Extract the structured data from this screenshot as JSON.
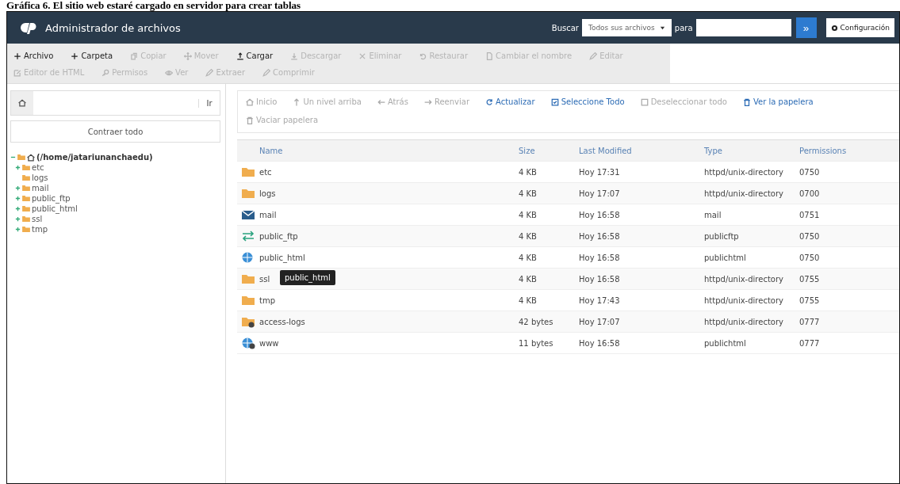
{
  "caption": "Gráfica 6. El sitio web estaré cargado en servidor para crear tablas",
  "header": {
    "title": "Administrador de archivos",
    "search_label": "Buscar",
    "search_scope": "Todos sus archivos",
    "for_label": "para",
    "go": "»",
    "settings": "Configuración"
  },
  "toolbar": [
    {
      "label": "Archivo",
      "kind": "plus",
      "disabled": false
    },
    {
      "label": "Carpeta",
      "kind": "plus",
      "disabled": false
    },
    {
      "label": "Copiar",
      "kind": "copy",
      "disabled": true
    },
    {
      "label": "Mover",
      "kind": "move",
      "disabled": true
    },
    {
      "label": "Cargar",
      "kind": "upload",
      "disabled": false
    },
    {
      "label": "Descargar",
      "kind": "download",
      "disabled": true
    },
    {
      "label": "Eliminar",
      "kind": "x",
      "disabled": true
    },
    {
      "label": "Restaurar",
      "kind": "undo",
      "disabled": true
    },
    {
      "label": "Cambiar el nombre",
      "kind": "file",
      "disabled": true
    },
    {
      "label": "Editar",
      "kind": "pencil",
      "disabled": true
    },
    {
      "label": "Editor de HTML",
      "kind": "edit",
      "disabled": true
    },
    {
      "label": "Permisos",
      "kind": "key",
      "disabled": true
    },
    {
      "label": "Ver",
      "kind": "eye",
      "disabled": true
    },
    {
      "label": "Extraer",
      "kind": "pencil",
      "disabled": true
    },
    {
      "label": "Comprimir",
      "kind": "pencil",
      "disabled": true
    }
  ],
  "sidebar": {
    "path_button": "Ir",
    "collapse_all": "Contraer todo",
    "tree": {
      "label": "(/home/jatariunanchaedu)",
      "expanded": true,
      "children": [
        {
          "label": "etc",
          "expanded": false
        },
        {
          "label": "logs"
        },
        {
          "label": "mail",
          "expanded": false
        },
        {
          "label": "public_ftp",
          "expanded": false
        },
        {
          "label": "public_html",
          "expanded": false
        },
        {
          "label": "ssl",
          "expanded": false
        },
        {
          "label": "tmp",
          "expanded": false
        }
      ]
    }
  },
  "nav": [
    {
      "label": "Inicio",
      "kind": "home",
      "disabled": true
    },
    {
      "label": "Un nivel arriba",
      "kind": "up",
      "disabled": true
    },
    {
      "label": "Atrás",
      "kind": "left",
      "disabled": true
    },
    {
      "label": "Reenviar",
      "kind": "right",
      "disabled": true
    },
    {
      "label": "Actualizar",
      "kind": "refresh",
      "disabled": false
    },
    {
      "label": "Seleccione Todo",
      "kind": "checkbox",
      "disabled": false
    },
    {
      "label": "Deseleccionar todo",
      "kind": "square",
      "disabled": true
    },
    {
      "label": "Ver la papelera",
      "kind": "trash",
      "disabled": false
    },
    {
      "label": "Vaciar papelera",
      "kind": "trash",
      "disabled": true
    }
  ],
  "table": {
    "columns": [
      "Name",
      "Size",
      "Last Modified",
      "Type",
      "Permissions"
    ],
    "rows": [
      {
        "kind": "folder",
        "name": "etc",
        "size": "4 KB",
        "modified": "Hoy 17:31",
        "type": "httpd/unix-directory",
        "permissions": "0750"
      },
      {
        "kind": "folder",
        "name": "logs",
        "size": "4 KB",
        "modified": "Hoy 17:07",
        "type": "httpd/unix-directory",
        "permissions": "0700"
      },
      {
        "kind": "mail",
        "name": "mail",
        "size": "4 KB",
        "modified": "Hoy 16:58",
        "type": "mail",
        "permissions": "0751"
      },
      {
        "kind": "transfer",
        "name": "public_ftp",
        "size": "4 KB",
        "modified": "Hoy 16:58",
        "type": "publicftp",
        "permissions": "0750"
      },
      {
        "kind": "globe",
        "name": "public_html",
        "size": "4 KB",
        "modified": "Hoy 16:58",
        "type": "publichtml",
        "permissions": "0750"
      },
      {
        "kind": "folder",
        "name": "ssl",
        "size": "4 KB",
        "modified": "Hoy 16:58",
        "type": "httpd/unix-directory",
        "permissions": "0755",
        "tooltip": "public_html"
      },
      {
        "kind": "folder",
        "name": "tmp",
        "size": "4 KB",
        "modified": "Hoy 17:43",
        "type": "httpd/unix-directory",
        "permissions": "0755"
      },
      {
        "kind": "folder-link",
        "name": "access-logs",
        "size": "42 bytes",
        "modified": "Hoy 17:07",
        "type": "httpd/unix-directory",
        "permissions": "0777"
      },
      {
        "kind": "globe-link",
        "name": "www",
        "size": "11 bytes",
        "modified": "Hoy 16:58",
        "type": "publichtml",
        "permissions": "0777"
      }
    ]
  }
}
